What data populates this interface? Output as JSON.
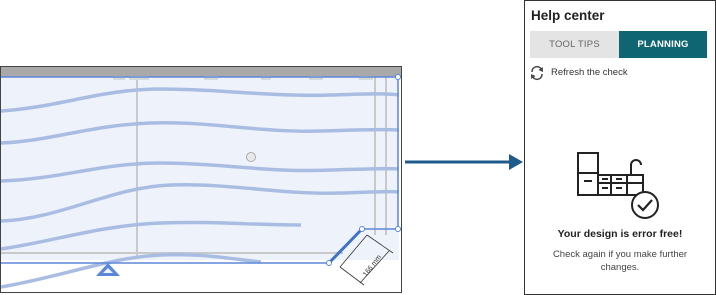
{
  "canvas": {
    "dimension_label": "166 mm"
  },
  "help_center": {
    "title": "Help center",
    "tabs": [
      {
        "label": "TOOL TIPS",
        "active": false
      },
      {
        "label": "PLANNING",
        "active": true
      }
    ],
    "refresh_label": "Refresh the check",
    "status_title": "Your design is error free!",
    "status_message": "Check again if you make further changes.",
    "icons": {
      "refresh": "refresh-icon",
      "status": "kitchen-check-icon"
    }
  },
  "colors": {
    "accent": "#0f6571",
    "arrow": "#1f5a8c",
    "selection": "#5b87d8",
    "wave": "#a9bde3",
    "tab_inactive": "#e4e4e4"
  }
}
